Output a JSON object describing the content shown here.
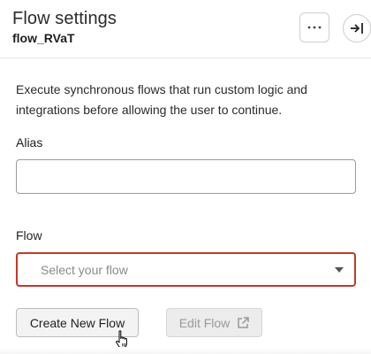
{
  "header": {
    "title": "Flow settings",
    "subtitle": "flow_RVaT",
    "more_icon": "ellipsis-icon",
    "collapse_icon": "collapse-panel-icon"
  },
  "content": {
    "description": "Execute synchronous flows that run custom logic and integrations before allowing the user to continue.",
    "alias": {
      "label": "Alias",
      "value": "",
      "placeholder": ""
    },
    "flow": {
      "label": "Flow",
      "placeholder": "Select your flow",
      "error_border_color": "#c0392b"
    }
  },
  "actions": {
    "create_label": "Create New Flow",
    "edit_label": "Edit Flow",
    "edit_icon": "external-link-icon"
  }
}
